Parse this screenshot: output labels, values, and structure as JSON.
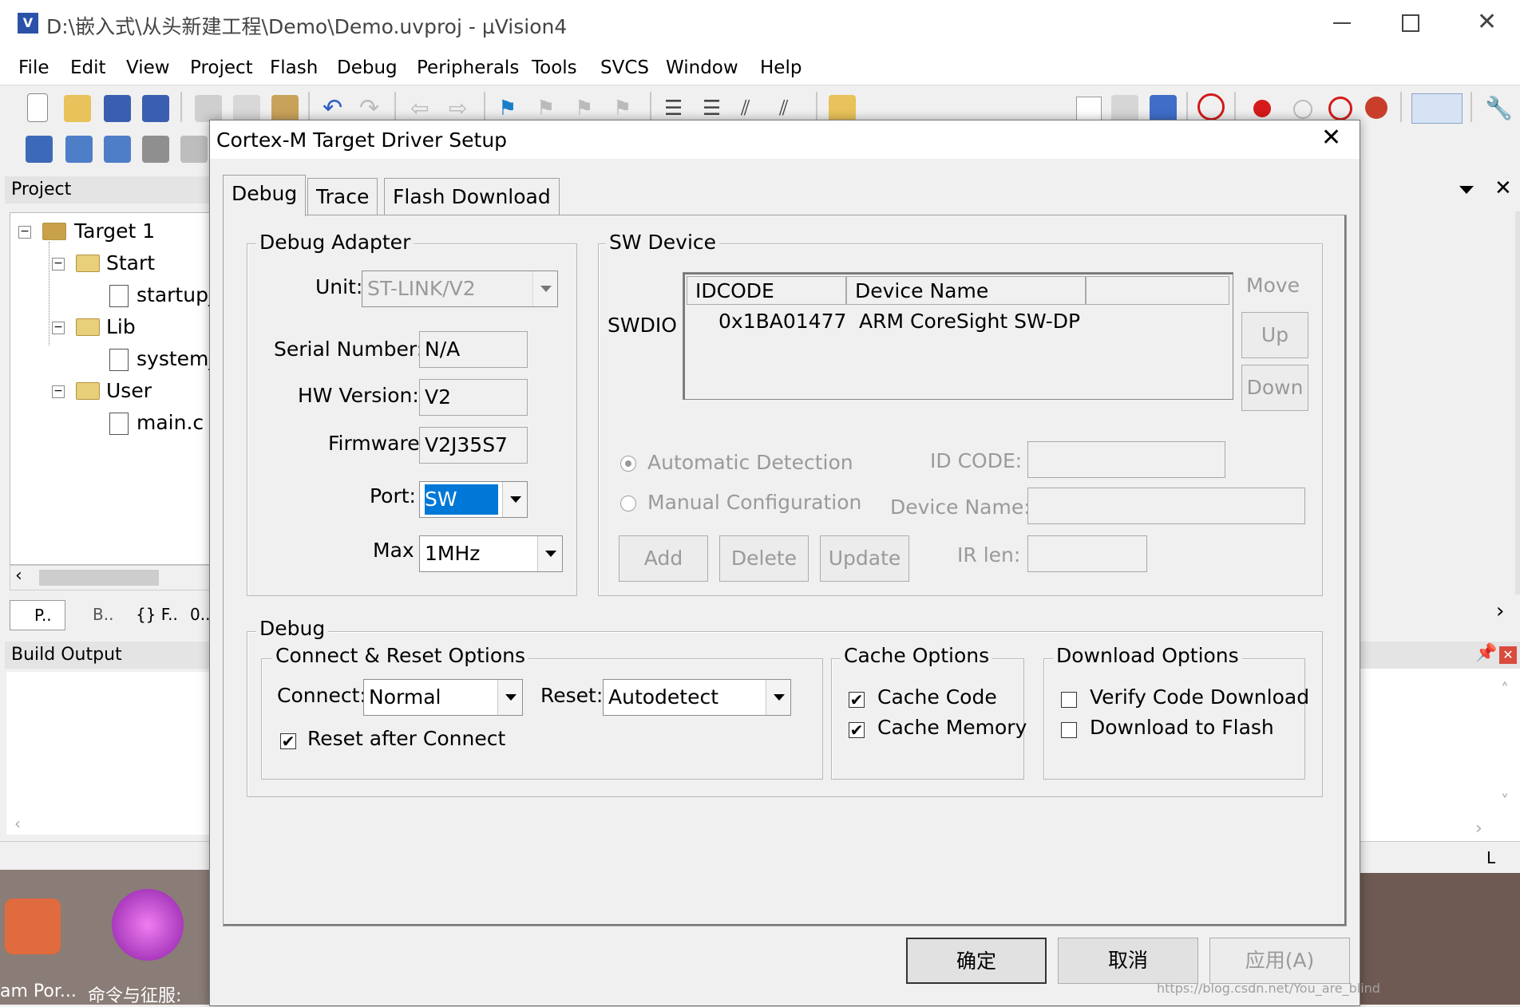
{
  "window": {
    "title": "D:\\嵌入式\\从头新建工程\\Demo\\Demo.uvproj - µVision4",
    "menu": [
      "File",
      "Edit",
      "View",
      "Project",
      "Flash",
      "Debug",
      "Peripherals",
      "Tools",
      "SVCS",
      "Window",
      "Help"
    ]
  },
  "project_pane": {
    "title": "Project",
    "tree": [
      {
        "label": "Target 1"
      },
      {
        "label": "Start"
      },
      {
        "label": "startup_"
      },
      {
        "label": "Lib"
      },
      {
        "label": "system_"
      },
      {
        "label": "User"
      },
      {
        "label": "main.c"
      }
    ],
    "tabs": [
      "P..",
      "B..",
      "{} F..",
      "0.."
    ]
  },
  "build_pane": {
    "title": "Build Output",
    "status_char": "L"
  },
  "desktop": {
    "labels": [
      "am Por...",
      "命令与征服:"
    ],
    "watermark": "https://blog.csdn.net/You_are_blind"
  },
  "dialog": {
    "title": "Cortex-M Target Driver Setup",
    "tabs": [
      "Debug",
      "Trace",
      "Flash Download"
    ],
    "debug_adapter": {
      "legend": "Debug Adapter",
      "unit_label": "Unit:",
      "unit_value": "ST-LINK/V2",
      "serial_label": "Serial Number:",
      "serial_value": "N/A",
      "hw_label": "HW Version:",
      "hw_value": "V2",
      "fw_label": "Firmware",
      "fw_value": "V2J35S7",
      "port_label": "Port:",
      "port_value": "SW",
      "max_label": "Max",
      "max_value": "1MHz"
    },
    "sw_device": {
      "legend": "SW Device",
      "row_label": "SWDIO",
      "col_idcode": "IDCODE",
      "col_name": "Device Name",
      "rows": [
        {
          "idcode": "0x1BA01477",
          "name": "ARM CoreSight SW-DP"
        }
      ],
      "move_label": "Move",
      "up": "Up",
      "down": "Down",
      "auto_detect": "Automatic Detection",
      "manual_config": "Manual Configuration",
      "id_code_label": "ID CODE:",
      "device_name_label": "Device Name:",
      "ir_len_label": "IR len:",
      "add": "Add",
      "delete": "Delete",
      "update": "Update"
    },
    "debug": {
      "legend": "Debug",
      "connect_reset": {
        "legend": "Connect & Reset Options",
        "connect_label": "Connect:",
        "connect_value": "Normal",
        "reset_label": "Reset:",
        "reset_value": "Autodetect",
        "reset_after_connect": "Reset after Connect"
      },
      "cache": {
        "legend": "Cache Options",
        "cache_code": "Cache Code",
        "cache_memory": "Cache Memory"
      },
      "download": {
        "legend": "Download Options",
        "verify": "Verify Code Download",
        "to_flash": "Download to Flash"
      }
    },
    "buttons": {
      "ok": "确定",
      "cancel": "取消",
      "apply": "应用(A)"
    }
  }
}
